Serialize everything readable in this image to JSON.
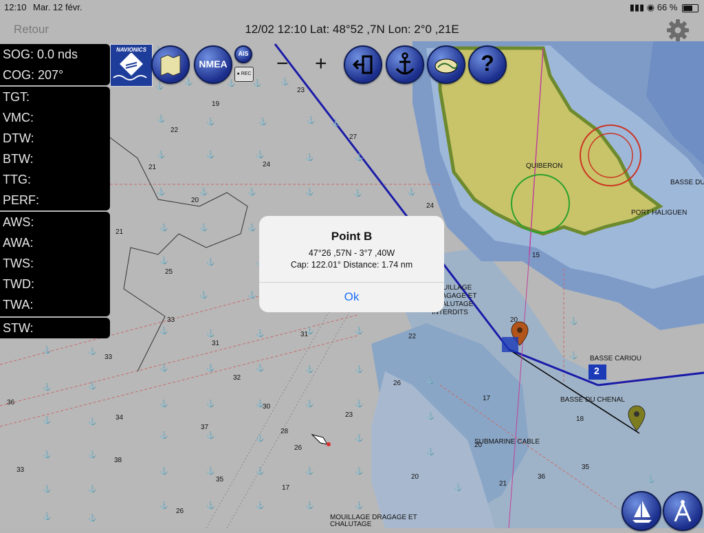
{
  "status_bar": {
    "time": "12:10",
    "date": "Mar. 12 févr.",
    "battery": "66 %"
  },
  "nav": {
    "back_label": "Retour",
    "title": "12/02 12:10  Lat: 48°52 ,7N Lon: 2°0 ,21E"
  },
  "instruments_top": [
    "SOG: 0.0 nds",
    "COG: 207°"
  ],
  "instruments_route": [
    "TGT:",
    "VMC:",
    "DTW:",
    "BTW:",
    "TTG:",
    "PERF:"
  ],
  "instruments_wind": [
    "AWS:",
    "AWA:",
    "TWS:",
    "TWD:",
    "TWA:"
  ],
  "instruments_speed": [
    "STW:"
  ],
  "toolbar": {
    "navionics_label": "NAVIONICS",
    "nmea_label": "NMEA",
    "ais_label": "AIS",
    "rec_label": "● REC",
    "zoom_out": "−",
    "zoom_in": "+",
    "help_label": "?"
  },
  "map_labels": {
    "quiberon": "QUIBERON",
    "port_haliguen": "PORT HALIGUEN",
    "basse_du": "BASSE DU",
    "basse_cariou": "BASSE CARIOU",
    "basse_du_chenal": "BASSE DU CHENAL",
    "submarine_cable": "SUBMARINE CABLE",
    "mouillage_interdits": "MOUILLAGE DRAGAGE ET CHALUTAGE INTERDITS",
    "mouillage_bottom": "MOUILLAGE DRAGAGE ET CHALUTAGE",
    "waypoint_number": "2"
  },
  "depth_soundings": [
    "23",
    "19",
    "22",
    "27",
    "21",
    "24",
    "20",
    "21",
    "24",
    "25",
    "33",
    "31",
    "31",
    "33",
    "32",
    "30",
    "28",
    "26",
    "23",
    "26",
    "22",
    "20",
    "15",
    "17",
    "20",
    "21",
    "18",
    "35",
    "36",
    "34",
    "37",
    "38",
    "33",
    "35",
    "26",
    "17",
    "20",
    "36"
  ],
  "dialog": {
    "title": "Point B",
    "coords": "47°26 ,57N - 3°7 ,40W",
    "info": "Cap: 122.01° Distance: 1.74 nm",
    "ok_label": "Ok"
  },
  "colors": {
    "route": "#1a1aa8",
    "land": "#c9c46a",
    "sea": "#8aa6c6",
    "panel": "#000000",
    "link": "#1a6ef5"
  }
}
